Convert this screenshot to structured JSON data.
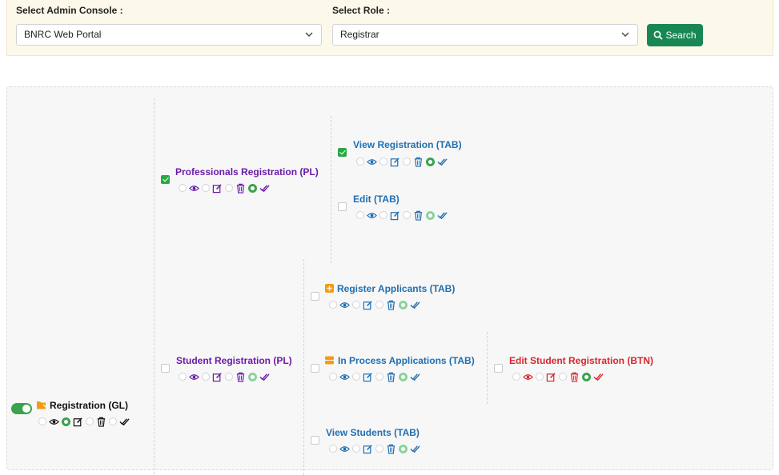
{
  "filters": {
    "console_label": "Select Admin Console :",
    "console_value": "BNRC Web Portal",
    "role_label": "Select Role :",
    "role_value": "Registrar",
    "search_label": "Search"
  },
  "tree": {
    "root": {
      "title": "Registration (GL)",
      "enabled": true
    },
    "pl1": {
      "title": "Professionals Registration (PL)",
      "checked": true
    },
    "tab_view_reg": {
      "title": "View Registration (TAB)",
      "checked": true
    },
    "tab_edit": {
      "title": "Edit (TAB)",
      "checked": false
    },
    "pl2": {
      "title": "Student Registration (PL)",
      "checked": false
    },
    "tab_register": {
      "title": "Register Applicants (TAB)",
      "checked": false
    },
    "tab_inprocess": {
      "title": "In Process Applications (TAB)",
      "checked": false
    },
    "btn_edit_student": {
      "title": "Edit Student Registration (BTN)",
      "checked": false
    },
    "tab_view_students": {
      "title": "View Students (TAB)",
      "checked": false
    }
  },
  "icons": [
    "chevron-down-icon",
    "search-icon",
    "eye-icon",
    "edit-icon",
    "trash-icon",
    "check-double-icon",
    "folder-icon",
    "plus-square-icon",
    "list-icon"
  ],
  "colors": {
    "purple": "#6a1aa8",
    "blue": "#1f6fb2",
    "red": "#d9262b",
    "green": "#198754"
  }
}
